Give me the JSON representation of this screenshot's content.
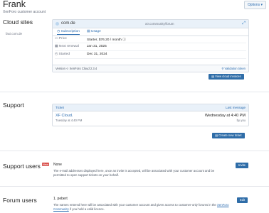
{
  "header": {
    "account_name": "Frank",
    "subtitle": "XenForo customer account",
    "options_label": "Options ▾"
  },
  "cloud_sites": {
    "title": "Cloud sites",
    "site_label": "faxi.com.de",
    "site": {
      "domain": "com.de",
      "community_url": "x0.community/forum",
      "tabs": [
        "Subscription",
        "Usage"
      ],
      "rows": [
        {
          "label": "Price",
          "value": "Starter, $76.20 / month ⓘ"
        },
        {
          "label": "Next renewal",
          "value": "Jan 31, 2025"
        },
        {
          "label": "Started",
          "value": "Dec 31, 2024"
        }
      ],
      "version": "Version ⟐ XenForo Cloud 2.3.4",
      "validation": "Validation token"
    },
    "view_button": "View cloud invoices"
  },
  "support": {
    "title": "Support",
    "columns": {
      "ticket": "Ticket",
      "last_message": "Last message"
    },
    "ticket": {
      "title": "XF Cloud.",
      "sub": "Tuesday at 4:40 PM",
      "last_message": "Wednesday at 4:40 PM",
      "by": "by you"
    },
    "create_button": "Create new ticket"
  },
  "support_users": {
    "title": "Support users",
    "badge": "New",
    "value": "None",
    "description": "The e-mail addresses displayed here, once an invite is accepted, will be associated with your customer account and be permitted to open support tickets on your behalf.",
    "invite_button": "Invite"
  },
  "forum_users": {
    "title": "Forum users",
    "value": "1. pebert",
    "description_pre": "The names entered here will be associated with your customer account and given access to customer-only forums in the ",
    "link": "XenForo Community",
    "description_post": " if you hold a valid licence.",
    "edit_button": "Edit"
  },
  "colors": {
    "accent": "#2f6da8",
    "link": "#2b6cb0",
    "badge": "#d9534f"
  }
}
